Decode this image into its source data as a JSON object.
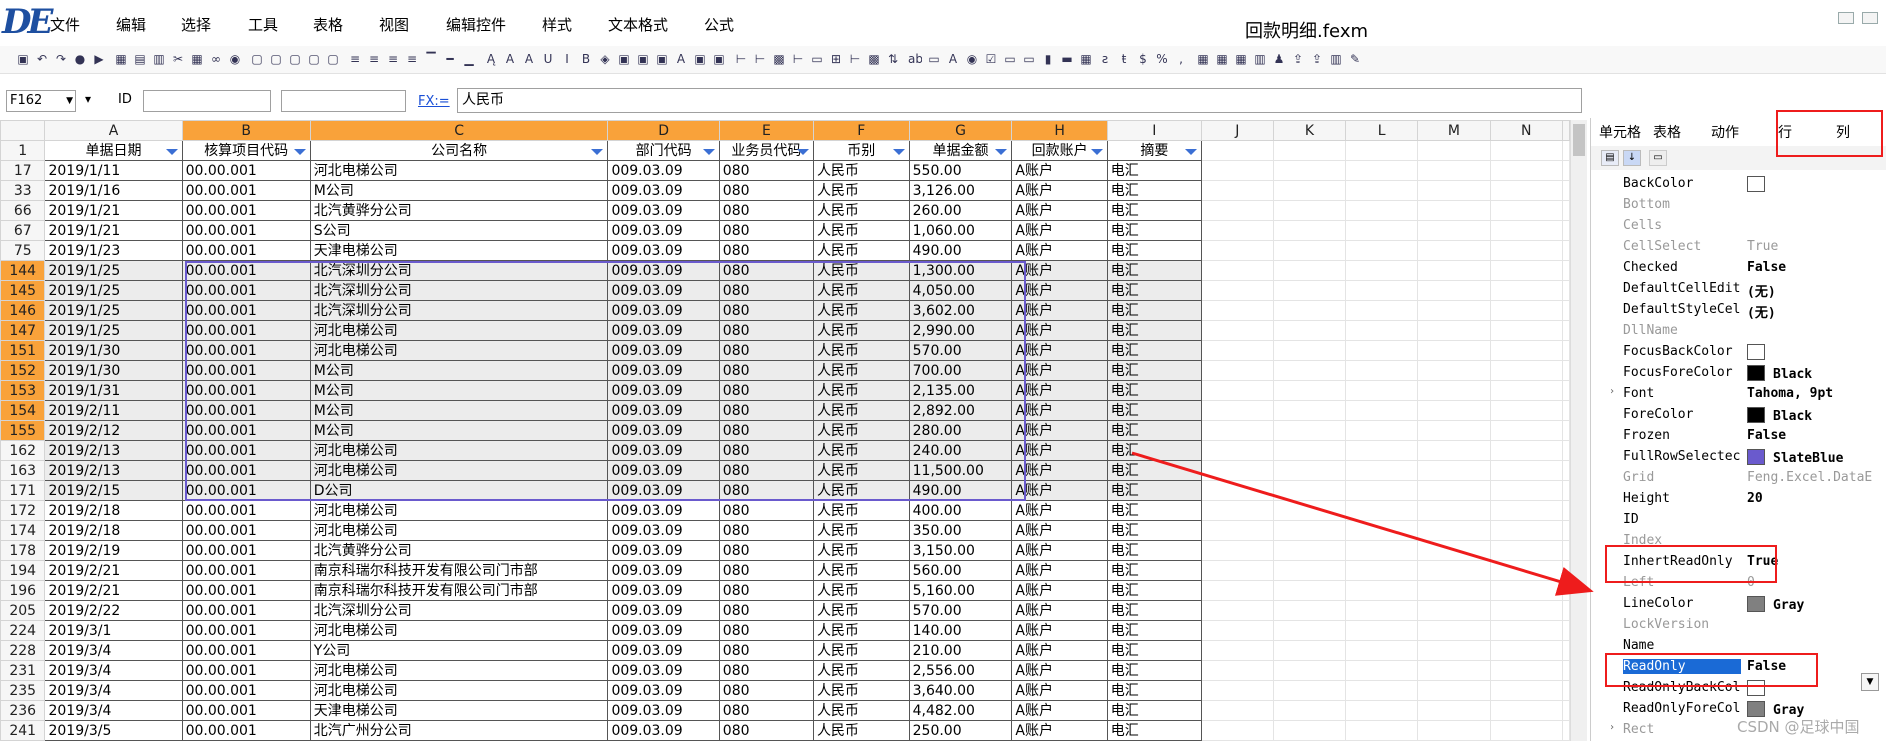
{
  "app": {
    "logo": "DE",
    "title": "回款明细.fexm"
  },
  "menu": [
    "文件",
    "编辑",
    "选择",
    "工具",
    "表格",
    "视图",
    "编辑控件",
    "样式",
    "文本格式",
    "公式"
  ],
  "toolbar_icons": [
    "save-icon",
    "undo-icon",
    "redo-icon",
    "record-icon",
    "play-icon",
    "grid-icon",
    "format-icon",
    "doc-icon",
    "cut-icon",
    "table-icon",
    "link-icon",
    "eye-icon",
    "border-icon",
    "border-icon",
    "border-icon",
    "border-icon",
    "border-icon",
    "align-left-icon",
    "align-center-icon",
    "align-right-icon",
    "align-justify-icon",
    "align-top-icon",
    "align-middle-icon",
    "align-bottom-icon",
    "font-icon",
    "font-grow-icon",
    "font-shrink-icon",
    "underline-icon",
    "italic-icon",
    "bold-icon",
    "fill-icon",
    "image-icon",
    "image-icon",
    "image-icon",
    "font-color-icon",
    "image-icon",
    "image-icon",
    "tree-icon",
    "tree-icon",
    "calc-icon",
    "tree-icon",
    "field-icon",
    "merge-icon",
    "tree-icon",
    "calc-icon",
    "sort-icon",
    "textbox-icon",
    "label-icon",
    "text-icon",
    "radio-icon",
    "checkbox-icon",
    "button-icon",
    "numeric-icon",
    "barcode-icon",
    "slider-icon",
    "date-icon",
    "formula-icon",
    "currency-icon",
    "dollar-icon",
    "percent-icon",
    "thousands-icon",
    "datetime-icon",
    "table-icon",
    "table-icon",
    "chart-icon",
    "user-icon",
    "export-icon",
    "export-icon",
    "chart-icon",
    "brush-icon"
  ],
  "formula_bar": {
    "cell_ref": "F162",
    "id_label": "ID",
    "id_value": "",
    "id_value2": "",
    "fx_label": "FX:=",
    "formula": "人民币"
  },
  "sheet": {
    "col_headers": [
      "A",
      "B",
      "C",
      "D",
      "E",
      "F",
      "G",
      "H",
      "I",
      "J",
      "K",
      "L",
      "M",
      "N"
    ],
    "field_row_label": "1",
    "fields": [
      "单据日期",
      "核算项目代码",
      "公司名称",
      "部门代码",
      "业务员代码",
      "币别",
      "单据金额",
      "回款账户",
      "摘要"
    ],
    "rows": [
      {
        "n": "17",
        "d": "2019/1/11",
        "a": "00.00.001",
        "c": "河北电梯公司",
        "dept": "009.03.09",
        "s": "080",
        "cur": "人民币",
        "amt": "550.00",
        "acct": "A账户",
        "m": "电汇"
      },
      {
        "n": "33",
        "d": "2019/1/16",
        "a": "00.00.001",
        "c": "M公司",
        "dept": "009.03.09",
        "s": "080",
        "cur": "人民币",
        "amt": "3,126.00",
        "acct": "A账户",
        "m": "电汇"
      },
      {
        "n": "66",
        "d": "2019/1/21",
        "a": "00.00.001",
        "c": "北汽黄骅分公司",
        "dept": "009.03.09",
        "s": "080",
        "cur": "人民币",
        "amt": "260.00",
        "acct": "A账户",
        "m": "电汇"
      },
      {
        "n": "67",
        "d": "2019/1/21",
        "a": "00.00.001",
        "c": "S公司",
        "dept": "009.03.09",
        "s": "080",
        "cur": "人民币",
        "amt": "1,060.00",
        "acct": "A账户",
        "m": "电汇"
      },
      {
        "n": "75",
        "d": "2019/1/23",
        "a": "00.00.001",
        "c": "天津电梯公司",
        "dept": "009.03.09",
        "s": "080",
        "cur": "人民币",
        "amt": "490.00",
        "acct": "A账户",
        "m": "电汇"
      },
      {
        "n": "144",
        "d": "2019/1/25",
        "a": "00.00.001",
        "c": "北汽深圳分公司",
        "dept": "009.03.09",
        "s": "080",
        "cur": "人民币",
        "amt": "1,300.00",
        "acct": "A账户",
        "m": "电汇"
      },
      {
        "n": "145",
        "d": "2019/1/25",
        "a": "00.00.001",
        "c": "北汽深圳分公司",
        "dept": "009.03.09",
        "s": "080",
        "cur": "人民币",
        "amt": "4,050.00",
        "acct": "A账户",
        "m": "电汇"
      },
      {
        "n": "146",
        "d": "2019/1/25",
        "a": "00.00.001",
        "c": "北汽深圳分公司",
        "dept": "009.03.09",
        "s": "080",
        "cur": "人民币",
        "amt": "3,602.00",
        "acct": "A账户",
        "m": "电汇"
      },
      {
        "n": "147",
        "d": "2019/1/25",
        "a": "00.00.001",
        "c": "河北电梯公司",
        "dept": "009.03.09",
        "s": "080",
        "cur": "人民币",
        "amt": "2,990.00",
        "acct": "A账户",
        "m": "电汇"
      },
      {
        "n": "151",
        "d": "2019/1/30",
        "a": "00.00.001",
        "c": "河北电梯公司",
        "dept": "009.03.09",
        "s": "080",
        "cur": "人民币",
        "amt": "570.00",
        "acct": "A账户",
        "m": "电汇"
      },
      {
        "n": "152",
        "d": "2019/1/30",
        "a": "00.00.001",
        "c": "M公司",
        "dept": "009.03.09",
        "s": "080",
        "cur": "人民币",
        "amt": "700.00",
        "acct": "A账户",
        "m": "电汇"
      },
      {
        "n": "153",
        "d": "2019/1/31",
        "a": "00.00.001",
        "c": "M公司",
        "dept": "009.03.09",
        "s": "080",
        "cur": "人民币",
        "amt": "2,135.00",
        "acct": "A账户",
        "m": "电汇"
      },
      {
        "n": "154",
        "d": "2019/2/11",
        "a": "00.00.001",
        "c": "M公司",
        "dept": "009.03.09",
        "s": "080",
        "cur": "人民币",
        "amt": "2,892.00",
        "acct": "A账户",
        "m": "电汇"
      },
      {
        "n": "155",
        "d": "2019/2/12",
        "a": "00.00.001",
        "c": "M公司",
        "dept": "009.03.09",
        "s": "080",
        "cur": "人民币",
        "amt": "280.00",
        "acct": "A账户",
        "m": "电汇"
      },
      {
        "n": "162",
        "d": "2019/2/13",
        "a": "00.00.001",
        "c": "河北电梯公司",
        "dept": "009.03.09",
        "s": "080",
        "cur": "人民币",
        "amt": "240.00",
        "acct": "A账户",
        "m": "电汇"
      },
      {
        "n": "163",
        "d": "2019/2/13",
        "a": "00.00.001",
        "c": "河北电梯公司",
        "dept": "009.03.09",
        "s": "080",
        "cur": "人民币",
        "amt": "11,500.00",
        "acct": "A账户",
        "m": "电汇"
      },
      {
        "n": "171",
        "d": "2019/2/15",
        "a": "00.00.001",
        "c": "D公司",
        "dept": "009.03.09",
        "s": "080",
        "cur": "人民币",
        "amt": "490.00",
        "acct": "A账户",
        "m": "电汇"
      },
      {
        "n": "172",
        "d": "2019/2/18",
        "a": "00.00.001",
        "c": "河北电梯公司",
        "dept": "009.03.09",
        "s": "080",
        "cur": "人民币",
        "amt": "400.00",
        "acct": "A账户",
        "m": "电汇"
      },
      {
        "n": "174",
        "d": "2019/2/18",
        "a": "00.00.001",
        "c": "河北电梯公司",
        "dept": "009.03.09",
        "s": "080",
        "cur": "人民币",
        "amt": "350.00",
        "acct": "A账户",
        "m": "电汇"
      },
      {
        "n": "178",
        "d": "2019/2/19",
        "a": "00.00.001",
        "c": "北汽黄骅分公司",
        "dept": "009.03.09",
        "s": "080",
        "cur": "人民币",
        "amt": "3,150.00",
        "acct": "A账户",
        "m": "电汇"
      },
      {
        "n": "194",
        "d": "2019/2/21",
        "a": "00.00.001",
        "c": "南京科瑞尔科技开发有限公司门市部",
        "dept": "009.03.09",
        "s": "080",
        "cur": "人民币",
        "amt": "560.00",
        "acct": "A账户",
        "m": "电汇"
      },
      {
        "n": "196",
        "d": "2019/2/21",
        "a": "00.00.001",
        "c": "南京科瑞尔科技开发有限公司门市部",
        "dept": "009.03.09",
        "s": "080",
        "cur": "人民币",
        "amt": "5,160.00",
        "acct": "A账户",
        "m": "电汇"
      },
      {
        "n": "205",
        "d": "2019/2/22",
        "a": "00.00.001",
        "c": "北汽深圳分公司",
        "dept": "009.03.09",
        "s": "080",
        "cur": "人民币",
        "amt": "570.00",
        "acct": "A账户",
        "m": "电汇"
      },
      {
        "n": "224",
        "d": "2019/3/1",
        "a": "00.00.001",
        "c": "河北电梯公司",
        "dept": "009.03.09",
        "s": "080",
        "cur": "人民币",
        "amt": "140.00",
        "acct": "A账户",
        "m": "电汇"
      },
      {
        "n": "228",
        "d": "2019/3/4",
        "a": "00.00.001",
        "c": "Y公司",
        "dept": "009.03.09",
        "s": "080",
        "cur": "人民币",
        "amt": "210.00",
        "acct": "A账户",
        "m": "电汇"
      },
      {
        "n": "231",
        "d": "2019/3/4",
        "a": "00.00.001",
        "c": "河北电梯公司",
        "dept": "009.03.09",
        "s": "080",
        "cur": "人民币",
        "amt": "2,556.00",
        "acct": "A账户",
        "m": "电汇"
      },
      {
        "n": "235",
        "d": "2019/3/4",
        "a": "00.00.001",
        "c": "河北电梯公司",
        "dept": "009.03.09",
        "s": "080",
        "cur": "人民币",
        "amt": "3,640.00",
        "acct": "A账户",
        "m": "电汇"
      },
      {
        "n": "236",
        "d": "2019/3/4",
        "a": "00.00.001",
        "c": "天津电梯公司",
        "dept": "009.03.09",
        "s": "080",
        "cur": "人民币",
        "amt": "4,482.00",
        "acct": "A账户",
        "m": "电汇"
      },
      {
        "n": "241",
        "d": "2019/3/5",
        "a": "00.00.001",
        "c": "北汽广州分公司",
        "dept": "009.03.09",
        "s": "080",
        "cur": "人民币",
        "amt": "250.00",
        "acct": "A账户",
        "m": "电汇"
      }
    ]
  },
  "panel": {
    "tabs": [
      "单元格",
      "表格",
      "动作",
      "行",
      "列"
    ],
    "props": [
      {
        "name": "BackColor",
        "value": "",
        "swatch": "#ffffff",
        "dis": false
      },
      {
        "name": "Bottom",
        "value": "",
        "dis": true
      },
      {
        "name": "Cells",
        "value": "",
        "dis": true
      },
      {
        "name": "CellSelect",
        "value": "True",
        "dis": true
      },
      {
        "name": "Checked",
        "value": "False",
        "dis": false
      },
      {
        "name": "DefaultCellEdit",
        "value": "(无)",
        "dis": false
      },
      {
        "name": "DefaultStyleCel",
        "value": "(无)",
        "dis": false
      },
      {
        "name": "DllName",
        "value": "",
        "dis": true
      },
      {
        "name": "FocusBackColor",
        "value": "",
        "swatch": "#ffffff",
        "dis": false
      },
      {
        "name": "FocusForeColor",
        "value": "Black",
        "swatch": "#000000",
        "dis": false
      },
      {
        "name": "Font",
        "value": "Tahoma, 9pt",
        "dis": false,
        "expand": true
      },
      {
        "name": "ForeColor",
        "value": "Black",
        "swatch": "#000000",
        "dis": false
      },
      {
        "name": "Frozen",
        "value": "False",
        "dis": false
      },
      {
        "name": "FullRowSelectec",
        "value": "SlateBlue",
        "swatch": "#6a5acd",
        "dis": false
      },
      {
        "name": "Grid",
        "value": "Feng.Excel.DataE",
        "dis": true
      },
      {
        "name": "Height",
        "value": "20",
        "dis": false
      },
      {
        "name": "ID",
        "value": "",
        "dis": false
      },
      {
        "name": "Index",
        "value": "",
        "dis": true
      },
      {
        "name": "InhertReadOnly",
        "value": "True",
        "dis": false
      },
      {
        "name": "Left",
        "value": "0",
        "dis": true
      },
      {
        "name": "LineColor",
        "value": "Gray",
        "swatch": "#808080",
        "dis": false
      },
      {
        "name": "LockVersion",
        "value": "",
        "dis": true
      },
      {
        "name": "Name",
        "value": "",
        "dis": false
      },
      {
        "name": "ReadOnly",
        "value": "False",
        "dis": false,
        "selected": true
      },
      {
        "name": "ReadOnlyBackCol",
        "value": "",
        "swatch": "#ffffff",
        "dis": false
      },
      {
        "name": "ReadOnlyForeCol",
        "value": "Gray",
        "swatch": "#808080",
        "dis": false
      },
      {
        "name": "Rect",
        "value": "",
        "dis": true,
        "expand": true
      }
    ]
  },
  "watermark": "CSDN @足球中国"
}
